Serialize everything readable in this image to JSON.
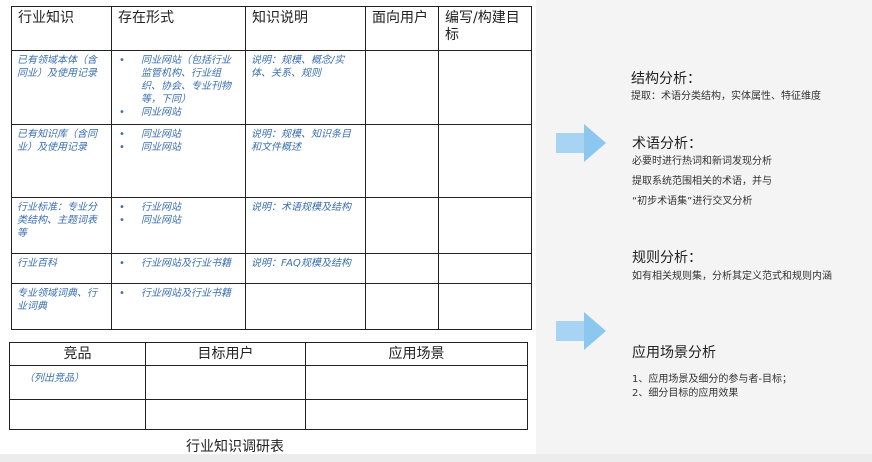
{
  "main_table": {
    "headers": [
      "行业知识",
      "存在形式",
      "知识说明",
      "面向用户",
      "编写/构建目标"
    ],
    "rows": [
      {
        "source": "已有领域本体（含同业）及使用记录",
        "forms": [
          "同业网站（包括行业监管机构、行业组织、协会、专业刊物等，下同）",
          "同业网站"
        ],
        "note": "说明：规模、概念/实体、关系、规则"
      },
      {
        "source": "已有知识库（含同业）及使用记录",
        "forms": [
          "同业网站",
          "同业网站"
        ],
        "note": "说明：规模、知识条目和文件概述"
      },
      {
        "source": "行业标准：专业分类结构、主题词表等",
        "forms": [
          "行业网站",
          "同业网站"
        ],
        "note": "说明：术语规模及结构"
      },
      {
        "source": "行业百科",
        "forms": [
          "行业网站及行业书籍"
        ],
        "note": "说明：FAQ规模及结构"
      },
      {
        "source": "专业领域词典、行业词典",
        "forms": [
          "行业网站及行业书籍"
        ],
        "note": ""
      }
    ]
  },
  "comp_table": {
    "headers": [
      "竞品",
      "目标用户",
      "应用场景"
    ],
    "placeholder": "（列出竞品）"
  },
  "caption": "行业知识调研表",
  "right": {
    "structure": {
      "title": "结构分析：",
      "text": "提取：术语分类结构，实体属性、特征维度"
    },
    "term": {
      "title": "术语分析：",
      "lines": [
        "必要时进行热词和新词发现分析",
        "提取系统范围相关的术语，并与",
        "“初步术语集”进行交叉分析"
      ]
    },
    "rule": {
      "title": "规则分析：",
      "text": "如有相关规则集，分析其定义范式和规则内涵"
    },
    "scene": {
      "title": "应用场景分析",
      "lines": [
        "1、应用场景及细分的参与者-目标；",
        "2、细分目标的应用效果"
      ]
    }
  },
  "colors": {
    "italic_blue": "#3a6fb0",
    "arrow": "#a8d4f3"
  },
  "icons": [
    "right-arrow-icon",
    "right-arrow-icon"
  ]
}
